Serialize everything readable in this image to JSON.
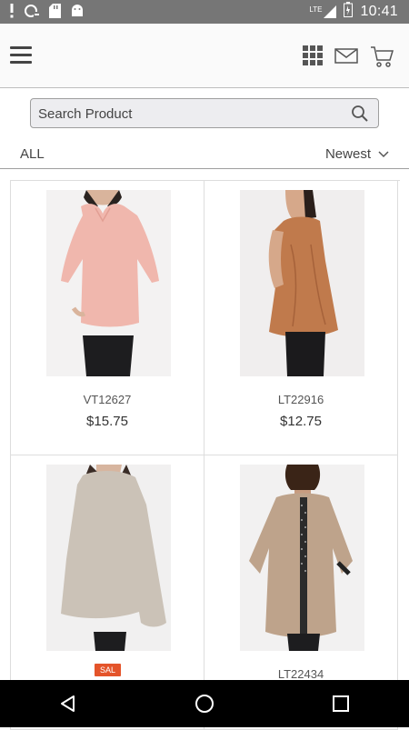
{
  "status_bar": {
    "time": "10:41",
    "network": "LTE",
    "left_icons": [
      "alert-icon",
      "sync-icon",
      "sd-card-icon",
      "android-icon"
    ]
  },
  "header": {
    "icons": [
      "menu-icon",
      "grid-view-icon",
      "mail-icon",
      "cart-icon"
    ]
  },
  "search": {
    "placeholder": "Search Product"
  },
  "filter": {
    "category": "ALL",
    "sort": "Newest"
  },
  "products": [
    {
      "code": "VT12627",
      "price": "$15.75",
      "badge": "",
      "shirt_color": "#f0b7ad",
      "bg": "#f3f2f2"
    },
    {
      "code": "LT22916",
      "price": "$12.75",
      "badge": "",
      "shirt_color": "#c07a4c",
      "bg": "#f0eeee"
    },
    {
      "code": "",
      "price": "",
      "badge": "SAL",
      "shirt_color": "#cbc2b7",
      "bg": "#f1f0f0"
    },
    {
      "code": "LT22434",
      "price": "",
      "badge": "",
      "shirt_color": "#bea38b",
      "bg": "#f2f1f1"
    }
  ],
  "colors": {
    "status_bar": "#767676",
    "badge": "#e4542a",
    "nav_bar": "#000000"
  }
}
